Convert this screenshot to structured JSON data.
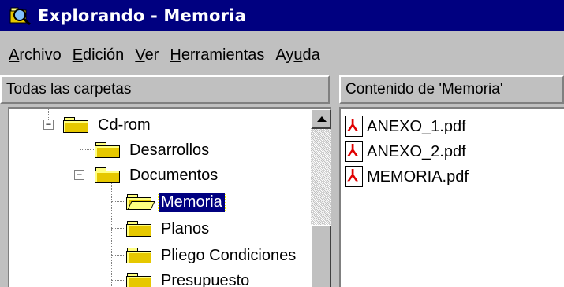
{
  "window": {
    "title": "Explorando - Memoria"
  },
  "menu": {
    "items": [
      {
        "accel": "A",
        "rest": "rchivo"
      },
      {
        "accel": "E",
        "rest": "dición"
      },
      {
        "accel": "V",
        "rest": "er"
      },
      {
        "accel": "H",
        "rest": "erramientas"
      },
      {
        "pre": "Ay",
        "accel": "u",
        "rest": "da"
      }
    ]
  },
  "left_pane": {
    "header": "Todas las carpetas",
    "tree": [
      {
        "label": "Cd-rom",
        "expander": "−"
      },
      {
        "label": "Desarrollos"
      },
      {
        "label": "Documentos",
        "expander": "−"
      },
      {
        "label": "Memoria",
        "selected": true,
        "open": true
      },
      {
        "label": "Planos"
      },
      {
        "label": "Pliego Condiciones"
      },
      {
        "label": "Presupuesto"
      }
    ]
  },
  "right_pane": {
    "header": "Contenido de 'Memoria'",
    "files": [
      {
        "name": "ANEXO_1.pdf",
        "icon": "pdf-icon"
      },
      {
        "name": "ANEXO_2.pdf",
        "icon": "pdf-icon"
      },
      {
        "name": "MEMORIA.pdf",
        "icon": "pdf-icon"
      }
    ]
  },
  "colors": {
    "titlebar": "#000080",
    "selection": "#000080",
    "face": "#c0c0c0"
  }
}
